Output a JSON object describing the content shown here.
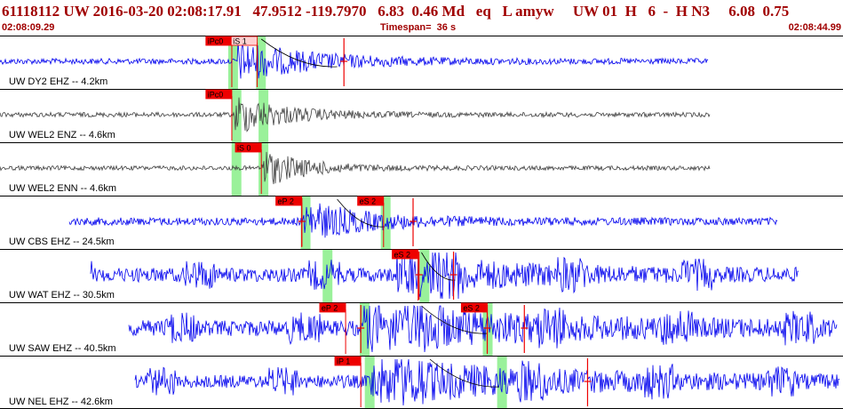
{
  "header": {
    "title": "61118112 UW 2016-03-20 02:08:17.91   47.9512 -119.7970   6.83  0.46 Md   eq   L amyw     UW 01  H   6  -  H N3     6.08  0.75",
    "start_time": "02:08:09.29",
    "timespan": "Timespan=  36 s",
    "end_time": "02:08:44.99"
  },
  "colors": {
    "header_text": "#a00000",
    "trace_blue": "#0000ee",
    "trace_gray": "#404040",
    "pick_red": "#ee0000",
    "pick_tag_bg": "#ee0000",
    "window_green": "#88ee88",
    "theoretical_curve": "#000000"
  },
  "channels": [
    {
      "label": "UW DY2 EHZ -- 4.2km",
      "color": "blue",
      "amp": 0.25,
      "trace_start": 0.0,
      "trace_end": 0.84,
      "signal": 0.28,
      "decay": 0.09,
      "picks": [
        {
          "tag": "iPc0",
          "t": 0.275,
          "style": "filled"
        },
        {
          "tag": "iS 1",
          "t": 0.305,
          "style": "outline"
        }
      ],
      "greens": [
        0.276,
        0.309
      ],
      "red_marks": [
        0.408
      ],
      "curve": [
        0.31,
        0.4
      ]
    },
    {
      "label": "UW WEL2 ENZ -- 4.6km",
      "color": "gray",
      "amp": 0.18,
      "trace_start": 0.0,
      "trace_end": 0.842,
      "signal": 0.278,
      "decay": 0.06,
      "picks": [
        {
          "tag": "iPc0",
          "t": 0.275,
          "style": "filled"
        }
      ],
      "greens": [
        0.28,
        0.312
      ],
      "red_marks": [],
      "curve": null
    },
    {
      "label": "UW WEL2 ENN -- 4.6km",
      "color": "gray",
      "amp": 0.16,
      "trace_start": 0.0,
      "trace_end": 0.842,
      "signal": 0.309,
      "decay": 0.05,
      "picks": [
        {
          "tag": "iS 0",
          "t": 0.31,
          "style": "filled"
        }
      ],
      "greens": [
        0.28,
        0.312
      ],
      "red_marks": [],
      "curve": null
    },
    {
      "label": "UW CBS EHZ -- 24.5km",
      "color": "blue",
      "amp": 0.4,
      "trace_start": 0.082,
      "trace_end": 0.922,
      "signal": 0.36,
      "decay": 0.07,
      "picks": [
        {
          "tag": "eP 2",
          "t": 0.358,
          "style": "filled"
        },
        {
          "tag": "eS 2",
          "t": 0.455,
          "style": "filled"
        }
      ],
      "greens": [
        0.362,
        0.457
      ],
      "red_marks": [
        0.358,
        0.49
      ],
      "curve": [
        0.4,
        0.455
      ]
    },
    {
      "label": "UW WAT EHZ -- 30.5km",
      "color": "blue",
      "amp": 0.85,
      "trace_start": 0.107,
      "trace_end": 0.947,
      "signal": 0.47,
      "decay": 0.12,
      "picks": [
        {
          "tag": "eS 2",
          "t": 0.496,
          "style": "filled"
        }
      ],
      "greens": [
        0.388,
        0.503
      ],
      "red_marks": [
        0.497,
        0.538
      ],
      "curve": [
        0.5,
        0.54
      ]
    },
    {
      "label": "UW SAW EHZ -- 40.5km",
      "color": "blue",
      "amp": 0.95,
      "trace_start": 0.153,
      "trace_end": 0.993,
      "signal": 0.43,
      "decay": 0.2,
      "picks": [
        {
          "tag": "eP 2",
          "t": 0.41,
          "style": "filled"
        },
        {
          "tag": "eS 2",
          "t": 0.578,
          "style": "filled"
        }
      ],
      "greens": [
        0.432,
        0.578
      ],
      "red_marks": [
        0.428,
        0.578,
        0.622
      ],
      "curve": [
        0.5,
        0.578
      ]
    },
    {
      "label": "UW NEL EHZ -- 42.6km",
      "color": "blue",
      "amp": 0.75,
      "trace_start": 0.16,
      "trace_end": 0.996,
      "signal": 0.44,
      "decay": 0.2,
      "picks": [
        {
          "tag": "iP 1",
          "t": 0.428,
          "style": "filled"
        }
      ],
      "greens": [
        0.438,
        0.595
      ],
      "red_marks": [
        0.697
      ],
      "curve": [
        0.51,
        0.592
      ]
    }
  ]
}
